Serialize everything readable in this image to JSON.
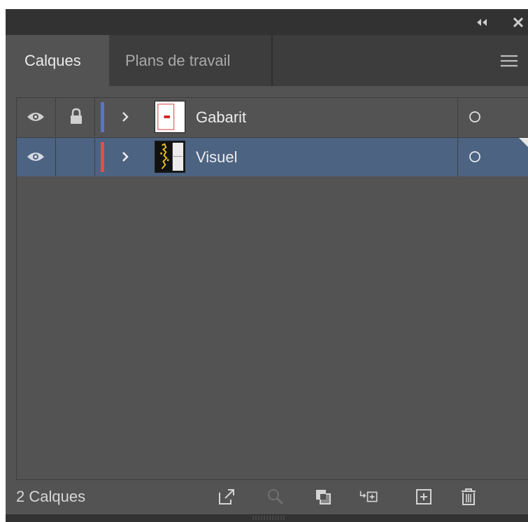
{
  "tabs": [
    {
      "label": "Calques",
      "active": true
    },
    {
      "label": "Plans de travail",
      "active": false
    }
  ],
  "layers": [
    {
      "name": "Gabarit",
      "visible": true,
      "locked": true,
      "color": "#5a76c0",
      "selected": false,
      "thumbnail": "white-page-with-red-mark"
    },
    {
      "name": "Visuel",
      "visible": true,
      "locked": false,
      "color": "#e24d4d",
      "selected": true,
      "thumbnail": "black-with-yellow-figure"
    }
  ],
  "footer": {
    "count_label": "2 Calques",
    "buttons": [
      "export-icon",
      "locate-object-icon",
      "make-clipping-mask-icon",
      "new-sublayer-icon",
      "new-layer-icon",
      "trash-icon"
    ]
  },
  "colors": {
    "panel_bg": "#535353",
    "titlebar_bg": "#323232",
    "tabbar_bg": "#3d3d3d",
    "selected_row": "#4c6382",
    "text": "#ececec"
  }
}
